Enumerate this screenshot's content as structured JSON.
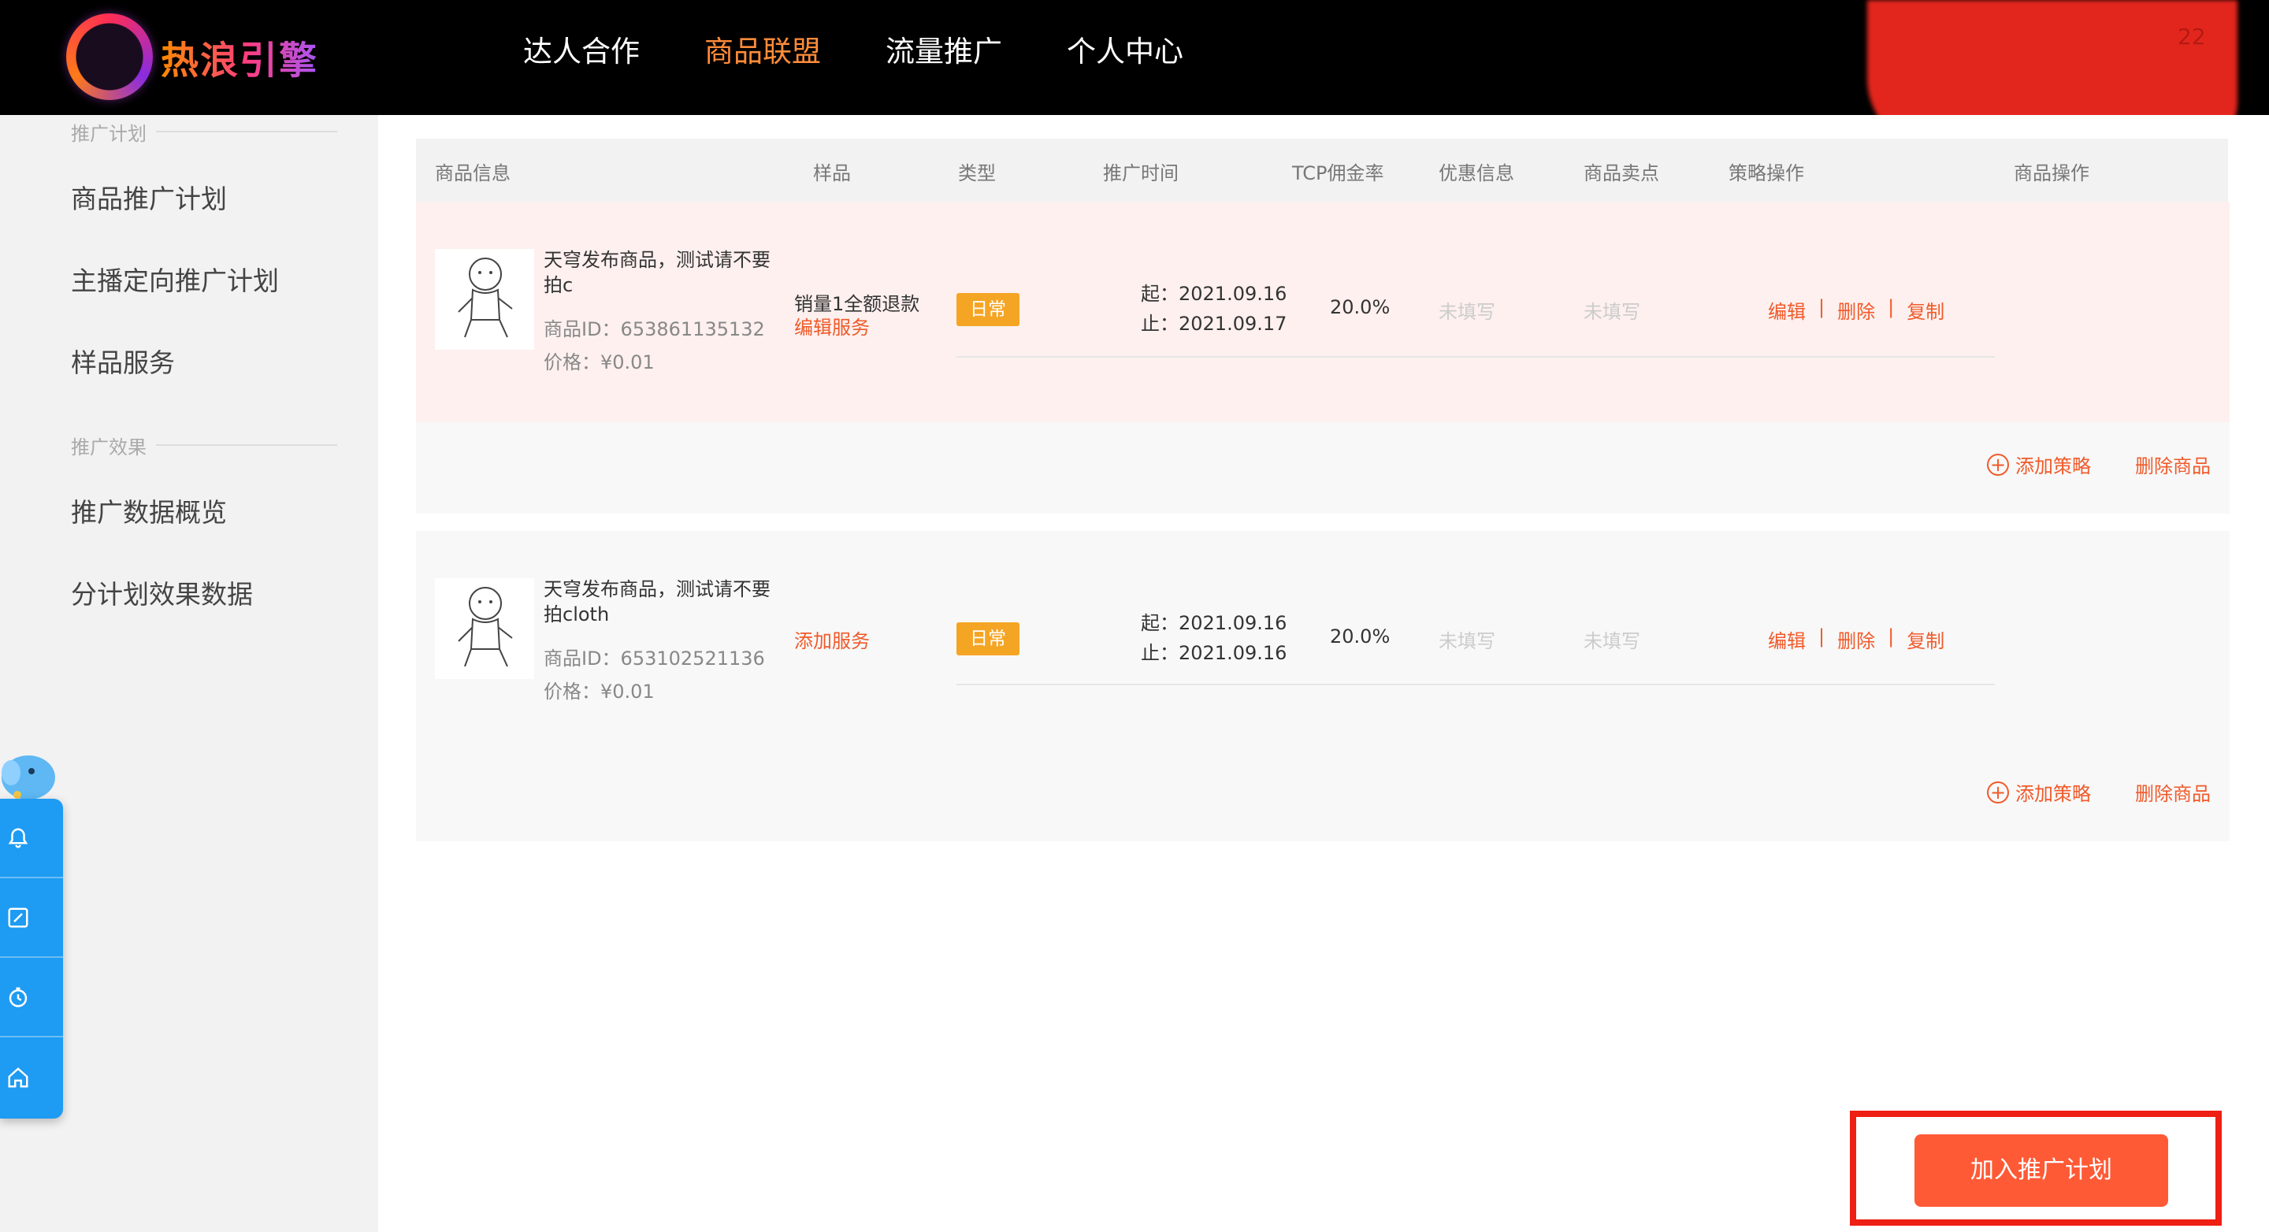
{
  "header": {
    "logo_text": "热浪引擎",
    "nav": [
      {
        "label": "达人合作"
      },
      {
        "label": "商品联盟"
      },
      {
        "label": "流量推广"
      },
      {
        "label": "个人中心"
      }
    ],
    "active_nav": "商品联盟",
    "user_partial": "22"
  },
  "sidebar": {
    "group1": "推广计划",
    "items1": [
      "商品推广计划",
      "主播定向推广计划",
      "样品服务"
    ],
    "group2": "推广效果",
    "items2": [
      "推广数据概览",
      "分计划效果数据"
    ]
  },
  "float_toolbar": {
    "icons": [
      "bell-icon",
      "edit-icon",
      "timer-icon",
      "home-icon"
    ]
  },
  "table": {
    "columns": [
      "商品信息",
      "样品",
      "类型",
      "推广时间",
      "TCP佣金率",
      "优惠信息",
      "商品卖点",
      "策略操作",
      "商品操作"
    ]
  },
  "products": [
    {
      "title": "天穹发布商品，测试请不要拍c",
      "id_label": "商品ID：653861135132",
      "price_label": "价格：¥0.01",
      "sample_text": "销量1全额退款",
      "sample_link": "编辑服务",
      "type": "日常",
      "start": "起：2021.09.16",
      "end": "止：2021.09.17",
      "rate": "20.0%",
      "discount": "未填写",
      "selling_point": "未填写",
      "ops": [
        "编辑",
        "删除",
        "复制"
      ],
      "add_strategy": "添加策略",
      "delete_product": "删除商品"
    },
    {
      "title": "天穹发布商品，测试请不要拍cloth",
      "id_label": "商品ID：653102521136",
      "price_label": "价格：¥0.01",
      "sample_text": "",
      "sample_link": "添加服务",
      "type": "日常",
      "start": "起：2021.09.16",
      "end": "止：2021.09.16",
      "rate": "20.0%",
      "discount": "未填写",
      "selling_point": "未填写",
      "ops": [
        "编辑",
        "删除",
        "复制"
      ],
      "add_strategy": "添加策略",
      "delete_product": "删除商品"
    }
  ],
  "cta": {
    "label": "加入推广计划"
  },
  "colors": {
    "accent": "#f05a2a",
    "cta": "#ff5a36",
    "tag": "#f5a524",
    "float": "#1e9bf2",
    "highlight_box": "#ee1f13"
  }
}
